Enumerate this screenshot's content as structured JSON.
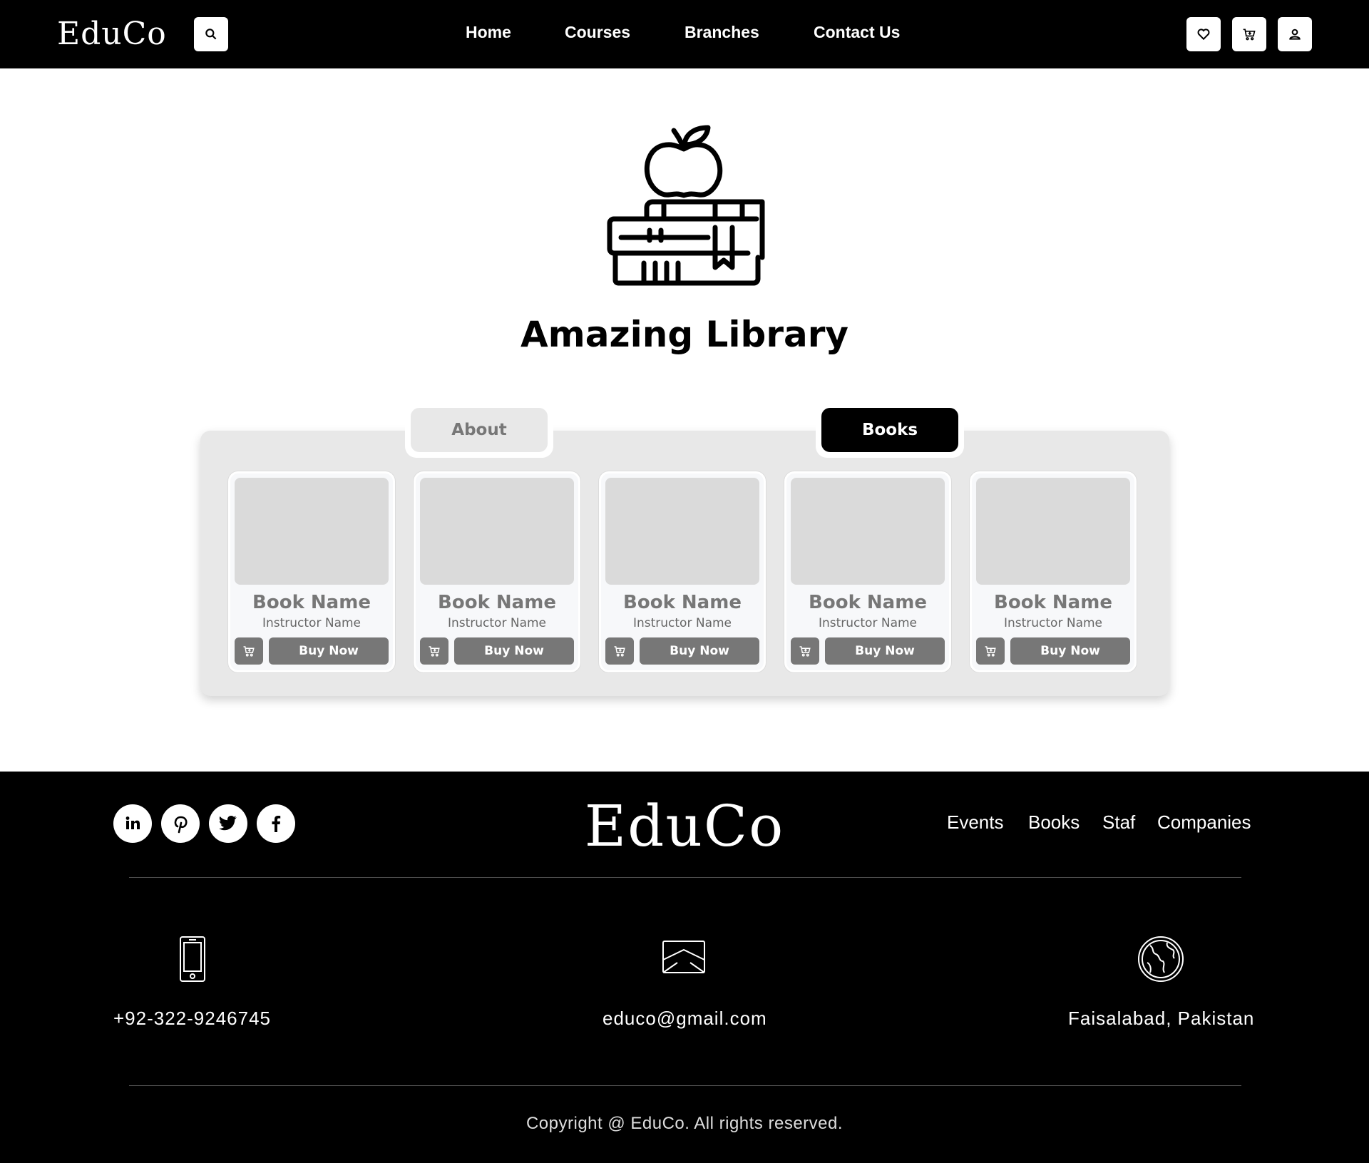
{
  "header": {
    "logo": "EduCo",
    "nav": [
      "Home",
      "Courses",
      "Branches",
      "Contact Us"
    ],
    "icons": [
      "search-icon",
      "heart-icon",
      "cart-icon",
      "user-icon"
    ]
  },
  "hero": {
    "icon": "books-apple-icon",
    "title": "Amazing Library"
  },
  "tabs": [
    {
      "label": "About",
      "active": false
    },
    {
      "label": "Books",
      "active": true
    }
  ],
  "cards": [
    {
      "title": "Book Name",
      "subtitle": "Instructor Name",
      "button": "Buy Now"
    },
    {
      "title": "Book Name",
      "subtitle": "Instructor Name",
      "button": "Buy Now"
    },
    {
      "title": "Book Name",
      "subtitle": "Instructor Name",
      "button": "Buy Now"
    },
    {
      "title": "Book Name",
      "subtitle": "Instructor Name",
      "button": "Buy Now"
    },
    {
      "title": "Book Name",
      "subtitle": "Instructor Name",
      "button": "Buy Now"
    }
  ],
  "footer": {
    "logo": "EduCo",
    "social": [
      "linkedin-icon",
      "pinterest-icon",
      "twitter-icon",
      "facebook-icon"
    ],
    "links": [
      "Events",
      "Books",
      "Staf",
      "Companies"
    ],
    "contacts": [
      {
        "icon": "phone-icon",
        "text": "+92-322-9246745"
      },
      {
        "icon": "mail-icon",
        "text": "educo@gmail.com"
      },
      {
        "icon": "globe-icon",
        "text": "Faisalabad, Pakistan"
      }
    ],
    "copyright": "Copyright @ EduCo. All rights reserved."
  },
  "colors": {
    "header_bg": "#000000",
    "panel_bg": "#e8e8e8",
    "button_gray": "#777777",
    "active_tab": "#000000"
  }
}
